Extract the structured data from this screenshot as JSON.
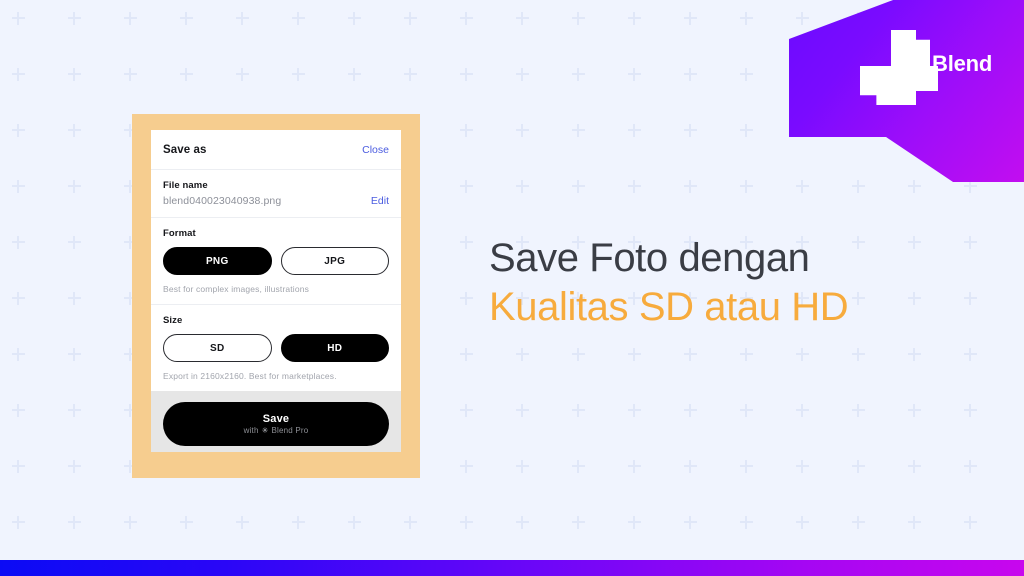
{
  "brand": {
    "name": "Blend",
    "logo_icon": "blend-pinwheel-icon",
    "accent_purple": "#7a0bff",
    "accent_magenta": "#c20df0"
  },
  "background": {
    "color": "#f0f4fe",
    "pattern_icon": "plus-tile-icon",
    "pattern_color": "#e0e7f8"
  },
  "mock": {
    "frame_color": "#f6cd8f",
    "sheet": {
      "title": "Save as",
      "close_label": "Close",
      "filename": {
        "label": "File name",
        "value": "blend040023040938.png",
        "edit_label": "Edit"
      },
      "format": {
        "label": "Format",
        "options": [
          {
            "label": "PNG",
            "selected": true
          },
          {
            "label": "JPG",
            "selected": false
          }
        ],
        "hint": "Best for complex images, illustrations"
      },
      "size": {
        "label": "Size",
        "options": [
          {
            "label": "SD",
            "selected": false
          },
          {
            "label": "HD",
            "selected": true
          }
        ],
        "hint": "Export in 2160x2160. Best for marketplaces."
      },
      "save": {
        "main_label": "Save",
        "sub_prefix": "with",
        "sub_glyph": "✳",
        "sub_label": "Blend Pro"
      }
    }
  },
  "headline": {
    "line1": "Save Foto dengan",
    "line2": "Kualitas SD atau HD",
    "line1_color": "#3a3d45",
    "line2_color": "#f7ab3d"
  },
  "bottom_bar": {
    "gradient_start": "#0b0bf5",
    "gradient_end": "#c806ee"
  }
}
